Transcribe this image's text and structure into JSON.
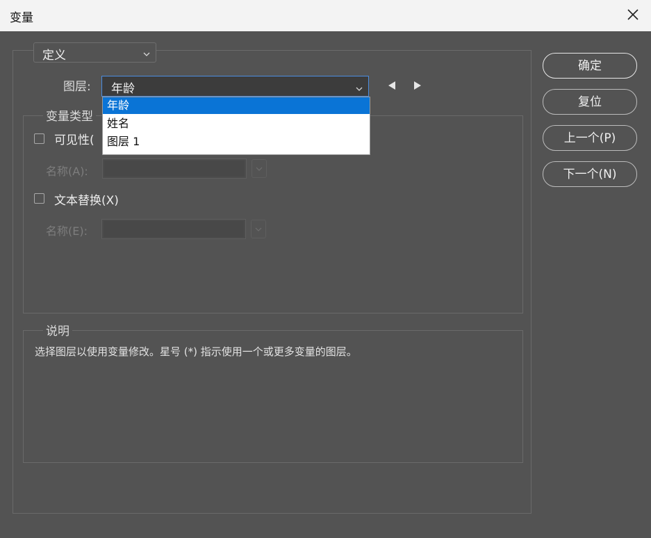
{
  "window": {
    "title": "变量",
    "close_icon": "close-icon"
  },
  "mode": {
    "selected": "定义"
  },
  "layer": {
    "label": "图层:",
    "selected": "年龄",
    "options": [
      "年龄",
      "姓名",
      "图层 1"
    ],
    "prev_icon": "triangle-left-icon",
    "next_icon": "triangle-right-icon"
  },
  "variable_types": {
    "title": "变量类型",
    "visibility": {
      "label": "可见性(",
      "checked": false,
      "name_label": "名称(A):",
      "name_value": ""
    },
    "text_replace": {
      "label": "文本替换(X)",
      "checked": false,
      "name_label": "名称(E):",
      "name_value": ""
    }
  },
  "description": {
    "title": "说明",
    "text": "选择图层以使用变量修改。星号 (*) 指示使用一个或更多变量的图层。"
  },
  "buttons": {
    "ok": "确定",
    "reset": "复位",
    "previous": "上一个(P)",
    "next": "下一个(N)"
  },
  "colors": {
    "dialog_bg": "#535353",
    "titlebar_bg": "#f3f3f3",
    "selection_blue": "#0a74d6",
    "focus_border": "#4b8de0"
  }
}
